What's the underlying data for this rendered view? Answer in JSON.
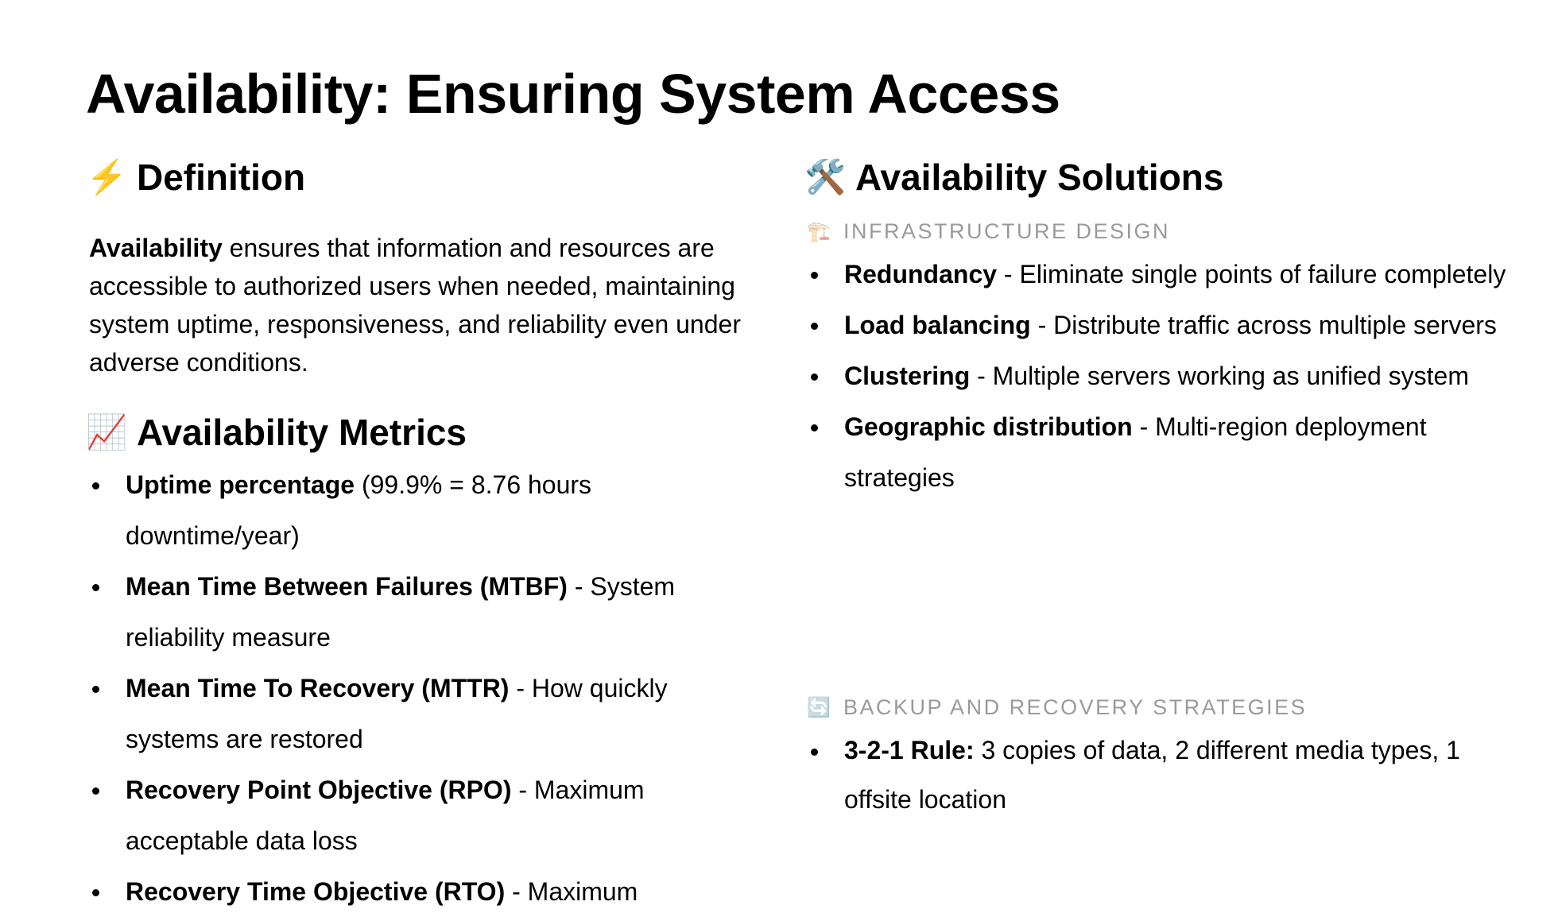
{
  "title": "Availability: Ensuring System Access",
  "definition": {
    "icon": "lightning-icon",
    "heading": "Definition",
    "term": "Availability",
    "text": " ensures that information and resources are accessible to authorized users when needed, maintaining system uptime, responsiveness, and reliability even under adverse conditions."
  },
  "metrics": {
    "icon": "chart-increasing-icon",
    "heading": "Availability Metrics",
    "items": [
      {
        "term": "Uptime percentage",
        "text": " (99.9% = 8.76 hours downtime/year)"
      },
      {
        "term": "Mean Time Between Failures (MTBF)",
        "text": " - System reliability measure"
      },
      {
        "term": "Mean Time To Recovery (MTTR)",
        "text": " - How quickly systems are restored"
      },
      {
        "term": "Recovery Point Objective (RPO)",
        "text": " - Maximum acceptable data loss"
      },
      {
        "term": "Recovery Time Objective (RTO)",
        "text": " - Maximum"
      }
    ]
  },
  "solutions": {
    "icon": "hammer-and-wrench-icon",
    "heading": "Availability Solutions",
    "infrastructure": {
      "icon": "construction-crane-icon",
      "label": "Infrastructure Design",
      "items": [
        {
          "term": "Redundancy",
          "text": " - Eliminate single points of failure completely"
        },
        {
          "term": "Load balancing",
          "text": " - Distribute traffic across multiple servers"
        },
        {
          "term": "Clustering",
          "text": " - Multiple servers working as unified system"
        },
        {
          "term": "Geographic distribution",
          "text": " - Multi-region deployment strategies"
        }
      ]
    },
    "backup": {
      "icon": "refresh-arrows-icon",
      "label": "Backup and Recovery Strategies",
      "items": [
        {
          "term": "3-2-1 Rule:",
          "text": " 3 copies of data, 2 different media types, 1 offsite location"
        }
      ]
    }
  }
}
